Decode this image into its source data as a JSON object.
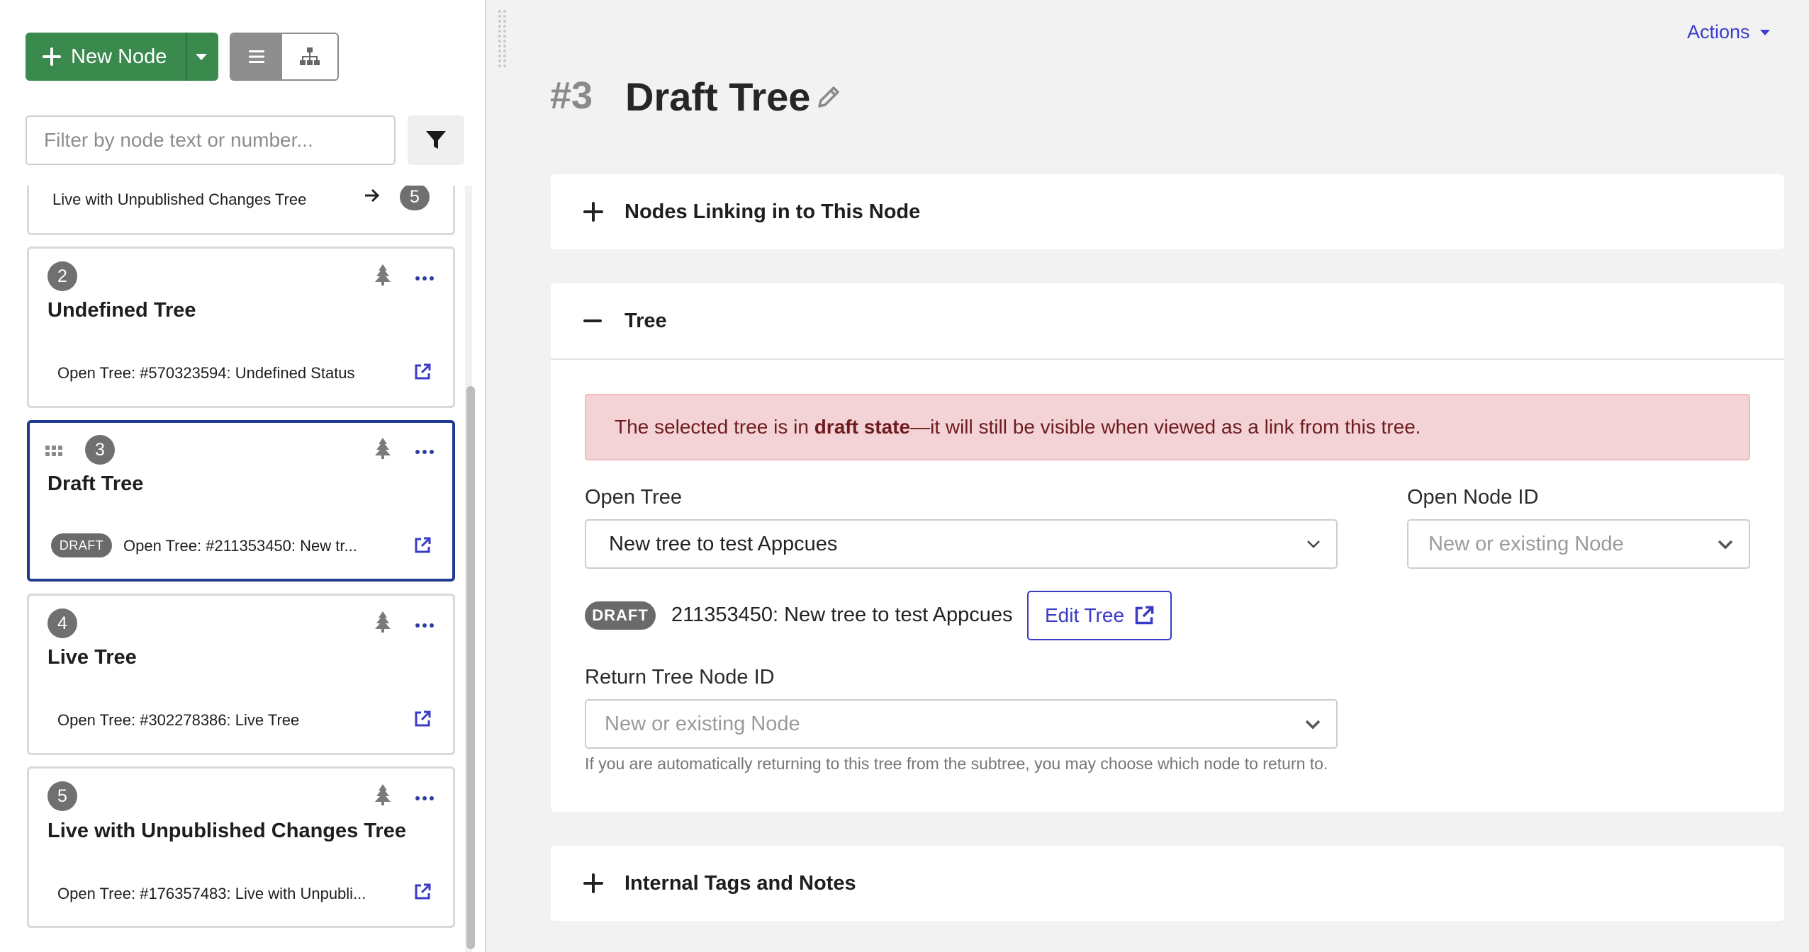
{
  "sidebar": {
    "new_node_label": "New Node",
    "filter_placeholder": "Filter by node text or number...",
    "partial_card": {
      "subtitle": "Live with Unpublished Changes Tree",
      "count": "5"
    },
    "cards": [
      {
        "number": "2",
        "title": "Undefined Tree",
        "subtitle": "Open Tree: #570323594: Undefined Status",
        "draft": ""
      },
      {
        "number": "3",
        "title": "Draft Tree",
        "subtitle": "Open Tree: #211353450: New tr...",
        "draft": "DRAFT"
      },
      {
        "number": "4",
        "title": "Live Tree",
        "subtitle": "Open Tree: #302278386: Live Tree",
        "draft": ""
      },
      {
        "number": "5",
        "title": "Live with Unpublished Changes Tree",
        "subtitle": "Open Tree: #176357483: Live with Unpubli...",
        "draft": ""
      }
    ]
  },
  "header": {
    "actions_label": "Actions",
    "node_number": "#3",
    "node_title": "Draft Tree"
  },
  "panels": {
    "linking": {
      "title": "Nodes Linking in to This Node"
    },
    "tree": {
      "title": "Tree",
      "alert_prefix": "The selected tree is in ",
      "alert_bold": "draft state",
      "alert_suffix": "—it will still be visible when viewed as a link from this tree.",
      "open_tree_label": "Open Tree",
      "open_tree_value": "New tree to test Appcues",
      "open_node_label": "Open Node ID",
      "open_node_placeholder": "New or existing Node",
      "draft_badge": "DRAFT",
      "tree_info": "211353450: New tree to test Appcues",
      "edit_tree_label": "Edit Tree",
      "return_label": "Return Tree Node ID",
      "return_placeholder": "New or existing Node",
      "return_help": "If you are automatically returning to this tree from the subtree, you may choose which node to return to."
    },
    "tags": {
      "title": "Internal Tags and Notes"
    }
  },
  "colors": {
    "primary_green": "#3a8a4e",
    "link_blue": "#3a3ac8",
    "selected_border": "#1f3a8f",
    "alert_bg": "#f3d3d5"
  }
}
